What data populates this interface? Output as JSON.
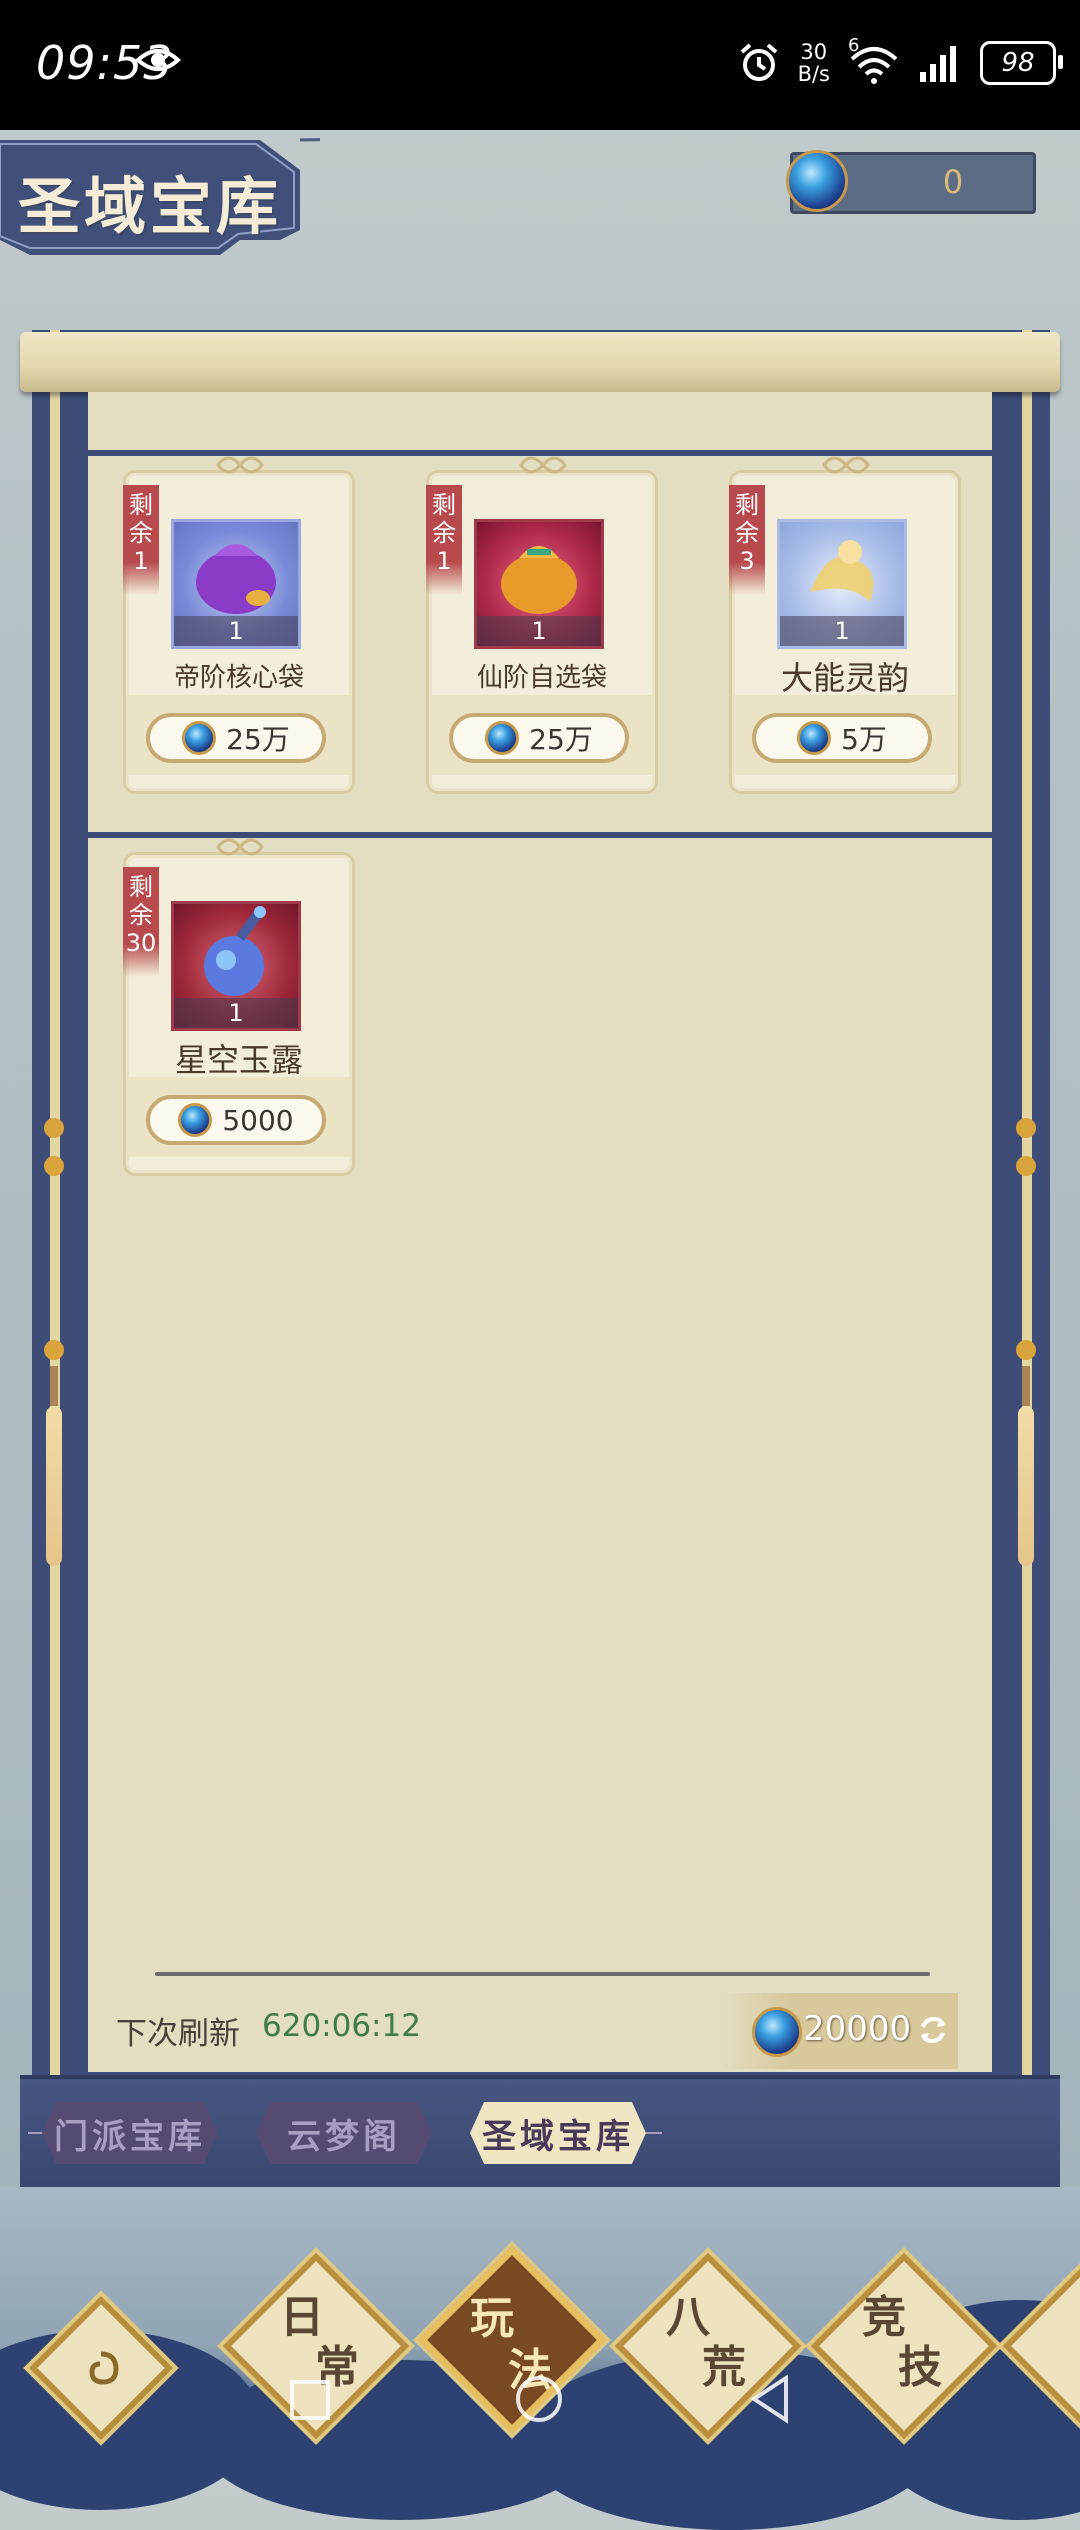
{
  "status_bar": {
    "time": "09:53",
    "net_speed_value": "30",
    "net_speed_unit": "B/s",
    "wifi_badge": "6",
    "battery": "98"
  },
  "header": {
    "title": "圣域宝库",
    "currency_value": "0"
  },
  "items": [
    {
      "stock_label": "剩余",
      "stock": "1",
      "quantity": "1",
      "name": "帝阶核心袋",
      "price": "25万",
      "icon": "purple-pouch-icon"
    },
    {
      "stock_label": "剩余",
      "stock": "1",
      "quantity": "1",
      "name": "仙阶自选袋",
      "price": "25万",
      "icon": "orange-pouch-icon"
    },
    {
      "stock_label": "剩余",
      "stock": "3",
      "quantity": "1",
      "name": "大能灵韵",
      "price": "5万",
      "icon": "golden-spirit-icon"
    },
    {
      "stock_label": "剩余",
      "stock": "30",
      "quantity": "1",
      "name": "星空玉露",
      "price": "5000",
      "icon": "starry-potion-icon"
    }
  ],
  "footer": {
    "refresh_label": "下次刷新",
    "refresh_time": "620:06:12",
    "balance": "20000"
  },
  "tabs": [
    {
      "label": "门派宝库",
      "active": false
    },
    {
      "label": "云梦阁",
      "active": false
    },
    {
      "label": "圣域宝库",
      "active": true
    }
  ],
  "bottom_nav": [
    {
      "label_top": "日",
      "label_bottom": "常",
      "active": false
    },
    {
      "label_top": "玩",
      "label_bottom": "法",
      "active": true
    },
    {
      "label_top": "八",
      "label_bottom": "荒",
      "active": false
    },
    {
      "label_top": "竞",
      "label_bottom": "技",
      "active": false
    }
  ],
  "colors": {
    "accent_blue": "#3d4d78",
    "paper": "#e3dec2",
    "stock_red": "#b84a4e",
    "timer_green": "#3f7c4a"
  }
}
